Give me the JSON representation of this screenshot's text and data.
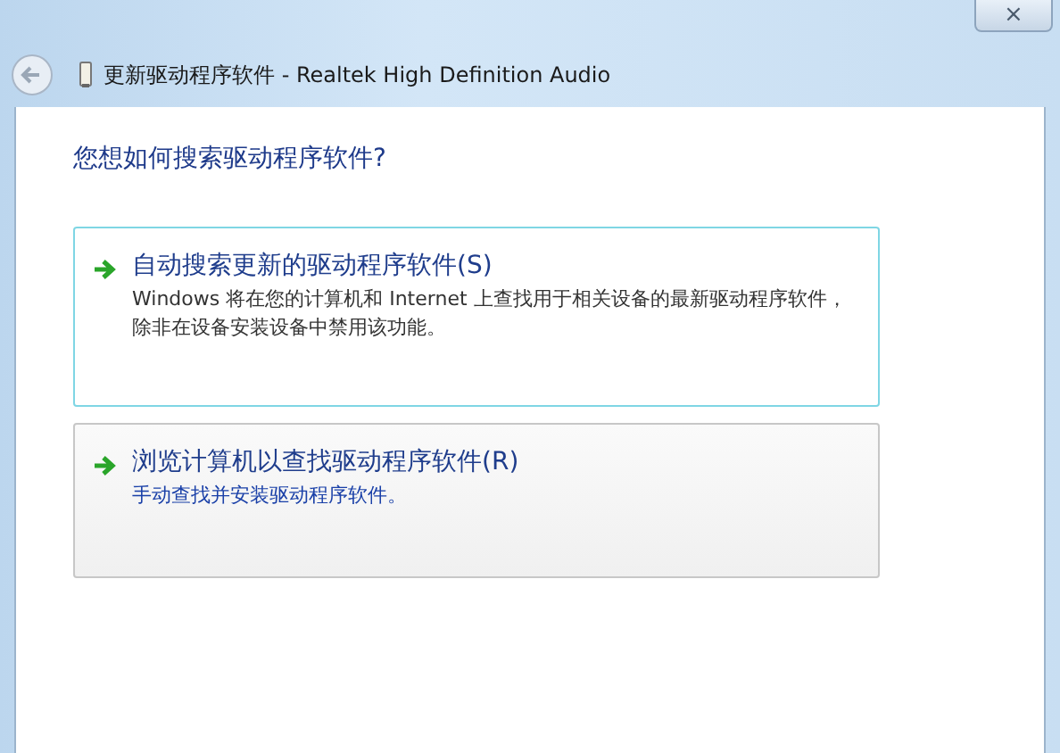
{
  "window": {
    "title": "更新驱动程序软件 - Realtek High Definition Audio",
    "close": "×"
  },
  "heading": "您想如何搜索驱动程序软件?",
  "options": [
    {
      "title": "自动搜索更新的驱动程序软件(S)",
      "description": "Windows 将在您的计算机和 Internet 上查找用于相关设备的最新驱动程序软件，除非在设备安装设备中禁用该功能。",
      "focused": true,
      "hovered": false
    },
    {
      "title": "浏览计算机以查找驱动程序软件(R)",
      "description": "手动查找并安装驱动程序软件。",
      "focused": false,
      "hovered": true
    }
  ]
}
